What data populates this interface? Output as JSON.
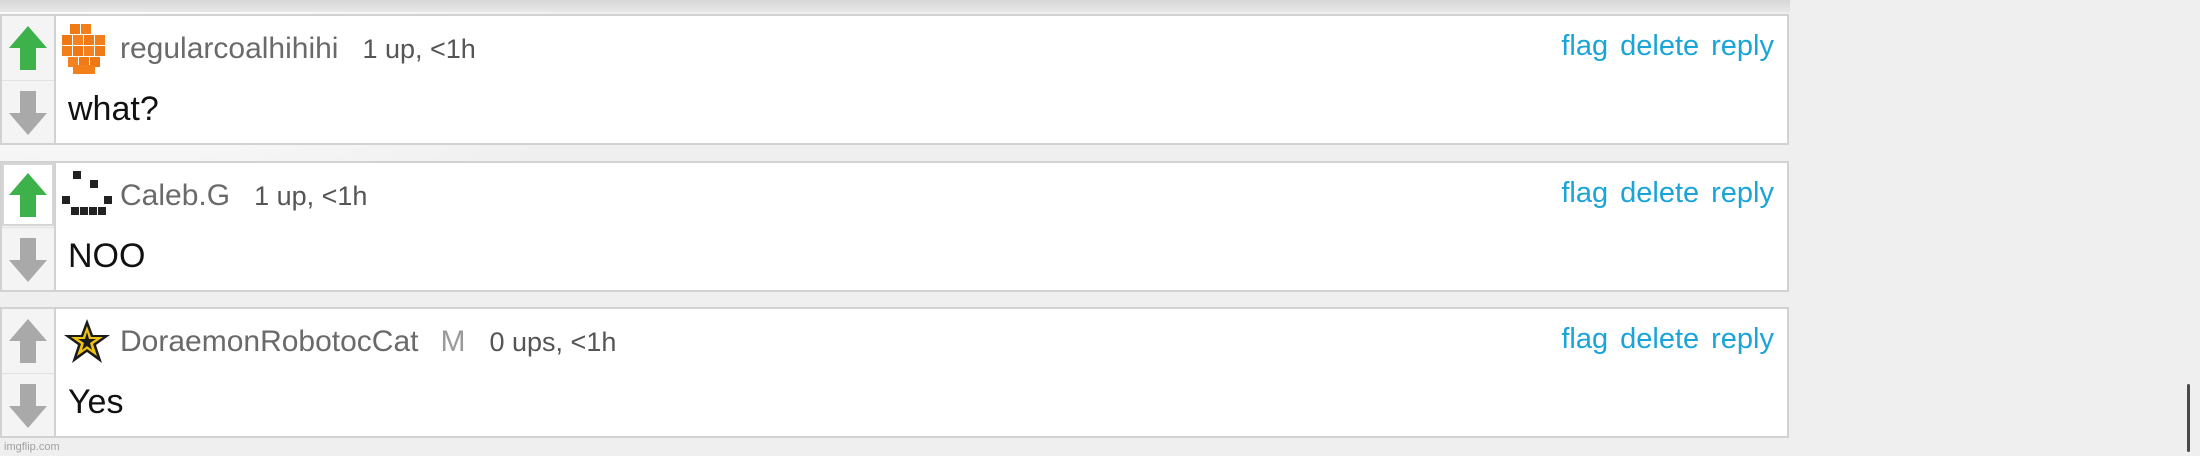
{
  "comments": [
    {
      "username": "regularcoalhihihi",
      "avatar_icon": "orange-blocks-avatar-icon",
      "meta": "1 up, <1h",
      "text": "what?",
      "upvoted": true,
      "actions": {
        "flag": "flag",
        "delete": "delete",
        "reply": "reply"
      }
    },
    {
      "username": "Caleb.G",
      "avatar_icon": "pixel-smiley-avatar-icon",
      "meta": "1 up, <1h",
      "text": "NOO",
      "upvoted": true,
      "actions": {
        "flag": "flag",
        "delete": "delete",
        "reply": "reply"
      }
    },
    {
      "username": "DoraemonRobotocCat",
      "badge": "M",
      "avatar_icon": "gold-star-avatar-icon",
      "meta": "0 ups, <1h",
      "text": "Yes",
      "upvoted": false,
      "actions": {
        "flag": "flag",
        "delete": "delete",
        "reply": "reply"
      }
    }
  ],
  "watermark": "imgflip.com",
  "colors": {
    "upvote_active": "#3db24a",
    "vote_inactive": "#a9a9a9",
    "action_link": "#1aa4d8"
  }
}
